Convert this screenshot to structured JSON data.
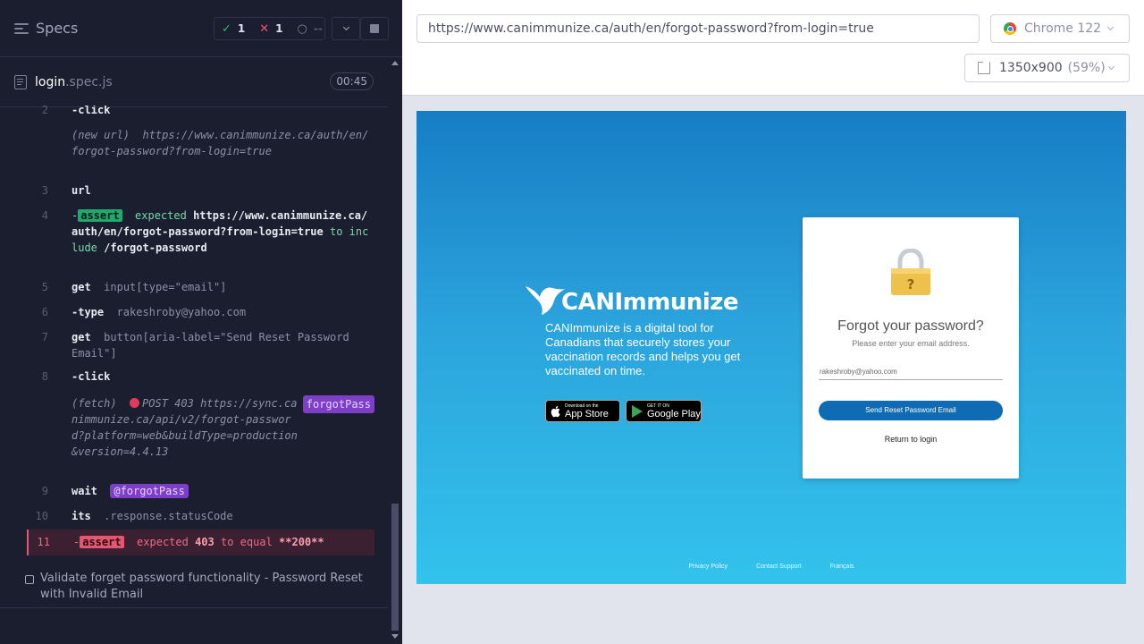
{
  "sidebar": {
    "title": "Specs",
    "stats": {
      "passed": "1",
      "failed": "1",
      "pending": "--"
    },
    "spec_file": {
      "name": "login",
      "ext": ".spec.js",
      "duration": "00:45"
    }
  },
  "commands": [
    {
      "n": "2",
      "name": "-click"
    },
    {
      "n": "",
      "prefix": "(new url)",
      "url": "https://www.canimmunize.ca/auth/en/forgot-password?from-login=true"
    },
    {
      "n": "3",
      "name": "url"
    },
    {
      "n": "4",
      "name": "-",
      "badge": "assert",
      "p1": "expected",
      "v1": "https://www.canimmunize.ca/auth/en/forgot-password?from-login=true",
      "p2": "to include",
      "v2": "/forgot-password"
    },
    {
      "n": "5",
      "name": "get",
      "arg": "input[type=\"email\"]"
    },
    {
      "n": "6",
      "name": "-type",
      "arg": "rakeshroby@yahoo.com"
    },
    {
      "n": "7",
      "name": "get",
      "arg": "button[aria-label=\"Send Reset Password Email\"]"
    },
    {
      "n": "8",
      "name": "-click"
    },
    {
      "n": "",
      "prefix": "(fetch)",
      "method": "POST 403",
      "url": "https://sync.canimmunize.ca/api/v2/forgot-password?platform=web&buildType=production&version=4.4.13",
      "alias": "forgotPass"
    },
    {
      "n": "9",
      "name": "wait",
      "alias": "@forgotPass"
    },
    {
      "n": "10",
      "name": "its",
      "arg": ".response.statusCode"
    },
    {
      "n": "11",
      "name": "-",
      "badge": "assert",
      "p1": "expected",
      "v1": "403",
      "p2": "to equal",
      "v2": "**200**"
    }
  ],
  "test_title": "Validate forget password functionality - Password Reset with Invalid Email",
  "browser": {
    "url": "https://www.canimmunize.ca/auth/en/forgot-password?from-login=true",
    "name": "Chrome 122",
    "viewport": "1350x900",
    "scale": "(59%)"
  },
  "app": {
    "logo": "CANImmunize",
    "tagline": "CANImmunize is a digital tool for Canadians that securely stores your vaccination records and helps you get vaccinated on time.",
    "appstore_small": "Download on the",
    "appstore_large": "App Store",
    "googleplay_small": "GET IT ON",
    "googleplay_large": "Google Play",
    "card_title": "Forgot your password?",
    "card_sub": "Please enter your email address.",
    "email_value": "rakeshroby@yahoo.com",
    "send_button": "Send Reset Password Email",
    "return_link": "Return to login",
    "footer": [
      "Privacy Policy",
      "Contact Support",
      "Français"
    ]
  }
}
